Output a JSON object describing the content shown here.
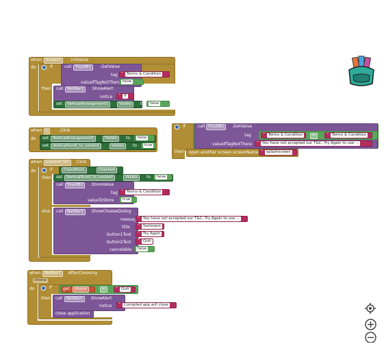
{
  "block1": {
    "when": "when",
    "component": "Screen1",
    "event": ".Initialize",
    "do": "do",
    "if": "if",
    "call": "call",
    "db": "TinyDB1",
    "method": ".GetValue",
    "tag_label": "tag",
    "tag_value": "Terms & Condition",
    "vitn_label": "valueIfTagNotThere",
    "vitn_value": "false",
    "then": "then",
    "notifier": "Notifier1",
    "show_alert": ".ShowAlert",
    "notice_label": "notice",
    "notice_value": "ff",
    "set": "set",
    "va": "VerticalArrangement1",
    "prop": "Visible",
    "to": "to",
    "val": "false"
  },
  "block2": {
    "when": "when",
    "component": "c",
    "event": ".Click",
    "do": "do",
    "set1": "set",
    "comp1": "VerticalArrangement1",
    "prop1": "Visible",
    "to1": "to",
    "val1": "false",
    "set2": "set",
    "comp2": "VerticalScroll_to_content",
    "prop2": "Visible",
    "to2": "to",
    "val2": "true"
  },
  "block3": {
    "when": "when",
    "component": "proceed_btn",
    "event": ".Click",
    "do": "do",
    "if": "if",
    "checkbox": "CheckBox1",
    "checked": "Checked",
    "then": "then",
    "set": "set",
    "vs": "VerticalScroll_to_content",
    "prop": "Visible",
    "to": "to",
    "val": "false",
    "call": "call",
    "db": "TinyDB1",
    "store": ".StoreValue",
    "tag_label": "tag",
    "tag_value": "Terms & Condition",
    "vts_label": "valueToStore",
    "vts_value": "true",
    "else": "else",
    "call2": "call",
    "notifier": "Notifier1",
    "dialog": ".ShowChooseDialog",
    "message_label": "message",
    "message_value": "You have not accepted our T&C, Try Again to use ...",
    "title_label": "title",
    "title_value": "Sorterpro",
    "b1_label": "button1Text",
    "b1_value": "Try Again",
    "b2_label": "button2Text",
    "b2_value": "Quit",
    "cancel_label": "cancelable",
    "cancel_value": "false"
  },
  "block4": {
    "if": "if",
    "call": "call",
    "db": "TinyDB1",
    "method": ".GetValue",
    "tag_label": "tag",
    "tag_value": "Terms & Condition",
    "eq": "=",
    "cmp_value": "Terms & Condition",
    "vitn_label": "valueIfTagNotThere",
    "vitn_value": "You have not accepted our T&C, Try Again to use ...",
    "then": "then",
    "open": "open another screen  screenName",
    "screen": "splashscreen"
  },
  "block5": {
    "when": "when",
    "component": "Notifier1",
    "event": ".AfterChoosing",
    "param": "choice",
    "do": "do",
    "if": "if",
    "get": "get",
    "var": "choice",
    "eq": "=",
    "cmp_value": "Quit",
    "then": "then",
    "call": "call",
    "notifier": "Notifier1",
    "show_alert": ".ShowAlert",
    "notice_label": "notice",
    "notice_value": "Compiled app will close",
    "close": "close application"
  },
  "workspace": {
    "backpack_icon": "backpack-icon",
    "center_icon": "target-icon",
    "zoom_in_icon": "plus-icon",
    "zoom_out_icon": "minus-icon"
  },
  "colors": {
    "event": "#b18e35",
    "procedure": "#7d5698",
    "setter": "#2d6e3a",
    "logic": "#5ba55b",
    "text": "#b32d5e"
  }
}
